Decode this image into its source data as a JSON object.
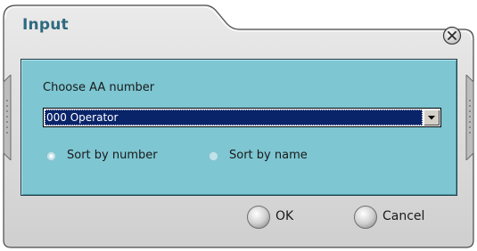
{
  "window": {
    "title": "Input",
    "close_icon": "close-icon"
  },
  "form": {
    "label": "Choose AA number",
    "select": {
      "selected": "000 Operator",
      "arrow_icon": "chevron-down-icon"
    },
    "sort_options": [
      {
        "label": "Sort by number",
        "checked": true
      },
      {
        "label": "Sort by name",
        "checked": false
      }
    ]
  },
  "buttons": {
    "ok": "OK",
    "cancel": "Cancel"
  },
  "colors": {
    "panel": "#7dc6d2",
    "title": "#2e6a80",
    "selection": "#0a246a",
    "frame": "#d7d7d7"
  }
}
